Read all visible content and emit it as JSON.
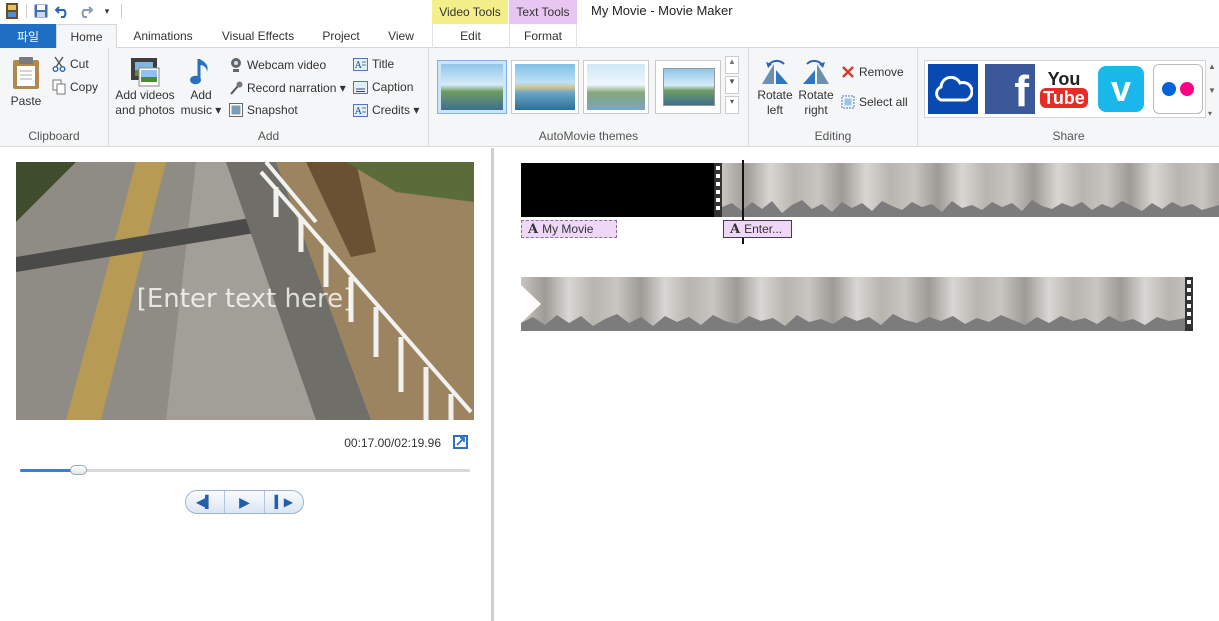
{
  "window": {
    "title": "My Movie - Movie Maker"
  },
  "quick_access": {
    "icons": [
      "app-icon",
      "save-icon",
      "undo-icon",
      "redo-icon",
      "customize-dropdown-icon"
    ]
  },
  "context_tabs": {
    "video_tools": "Video Tools",
    "text_tools": "Text Tools"
  },
  "tabs": {
    "file": "파일",
    "home": "Home",
    "animations": "Animations",
    "visual_effects": "Visual Effects",
    "project": "Project",
    "view": "View",
    "edit": "Edit",
    "format": "Format"
  },
  "ribbon": {
    "clipboard": {
      "label": "Clipboard",
      "paste": "Paste",
      "cut": "Cut",
      "copy": "Copy"
    },
    "add": {
      "label": "Add",
      "add_videos_line1": "Add videos",
      "add_videos_line2": "and photos",
      "add_music_line1": "Add",
      "add_music_line2": "music ▾",
      "webcam_video": "Webcam video",
      "record_narration": "Record narration ▾",
      "snapshot": "Snapshot",
      "title": "Title",
      "caption": "Caption",
      "credits": "Credits ▾"
    },
    "themes": {
      "label": "AutoMovie themes"
    },
    "editing": {
      "label": "Editing",
      "rotate_left_1": "Rotate",
      "rotate_left_2": "left",
      "rotate_right_1": "Rotate",
      "rotate_right_2": "right",
      "remove": "Remove",
      "select_all": "Select all"
    },
    "share": {
      "label": "Share",
      "youtube_1": "You",
      "youtube_2": "Tube"
    }
  },
  "preview": {
    "overlay_text": "[Enter text here]",
    "timecode": "00:17.00/02:19.96",
    "progress_fraction": 0.129
  },
  "storyboard": {
    "caption_title": "My Movie",
    "caption_enter": "Enter..."
  },
  "colors": {
    "file_tab": "#1f6fc5",
    "video_tools": "#f4ef8a",
    "text_tools": "#e7c6f1",
    "facebook": "#3b5998",
    "vimeo": "#1ab7ea",
    "onedrive": "#094ab2",
    "youtube": "#e52d27"
  }
}
